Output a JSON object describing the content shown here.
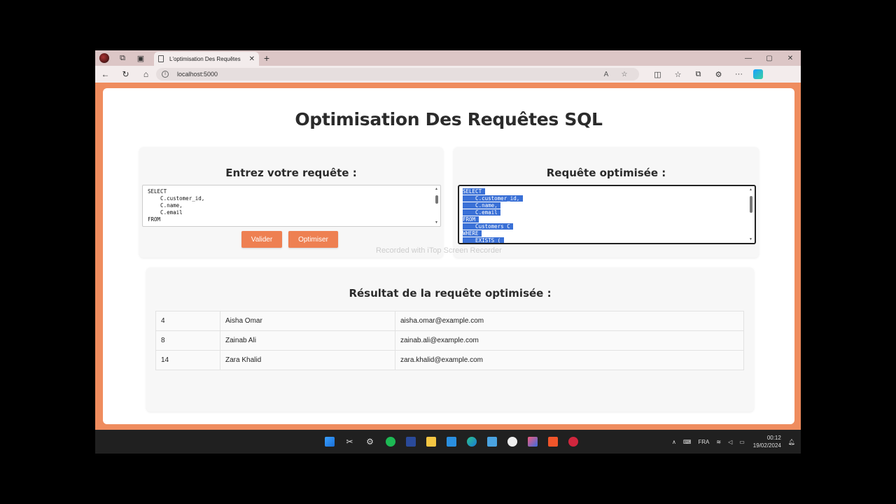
{
  "browser": {
    "tab_title": "L'optimisation Des Requêtes",
    "url": "localhost:5000"
  },
  "page": {
    "title": "Optimisation Des Requêtes SQL",
    "input_heading": "Entrez votre requête :",
    "input_sql": "SELECT\n    C.customer_id,\n    C.name,\n    C.email\nFROM",
    "validate_label": "Valider",
    "optimize_label": "Optimiser",
    "output_heading": "Requête optimisée :",
    "output_sql_lines": [
      "SELECT",
      "    C.customer_id,",
      "    C.name,",
      "    C.email",
      "FROM",
      "    Customers C",
      "WHERE",
      "    EXISTS ("
    ],
    "result_heading": "Résultat de la requête optimisée :",
    "results": [
      {
        "id": "4",
        "name": "Aisha Omar",
        "email": "aisha.omar@example.com"
      },
      {
        "id": "8",
        "name": "Zainab Ali",
        "email": "zainab.ali@example.com"
      },
      {
        "id": "14",
        "name": "Zara Khalid",
        "email": "zara.khalid@example.com"
      }
    ]
  },
  "watermark": "Recorded with iTop Screen Recorder",
  "taskbar": {
    "language": "FRA",
    "time": "00:12",
    "date": "19/02/2024"
  },
  "colors": {
    "accent": "#ee8052",
    "page_bg": "#ef8c5e",
    "selection": "#3a70d6"
  }
}
